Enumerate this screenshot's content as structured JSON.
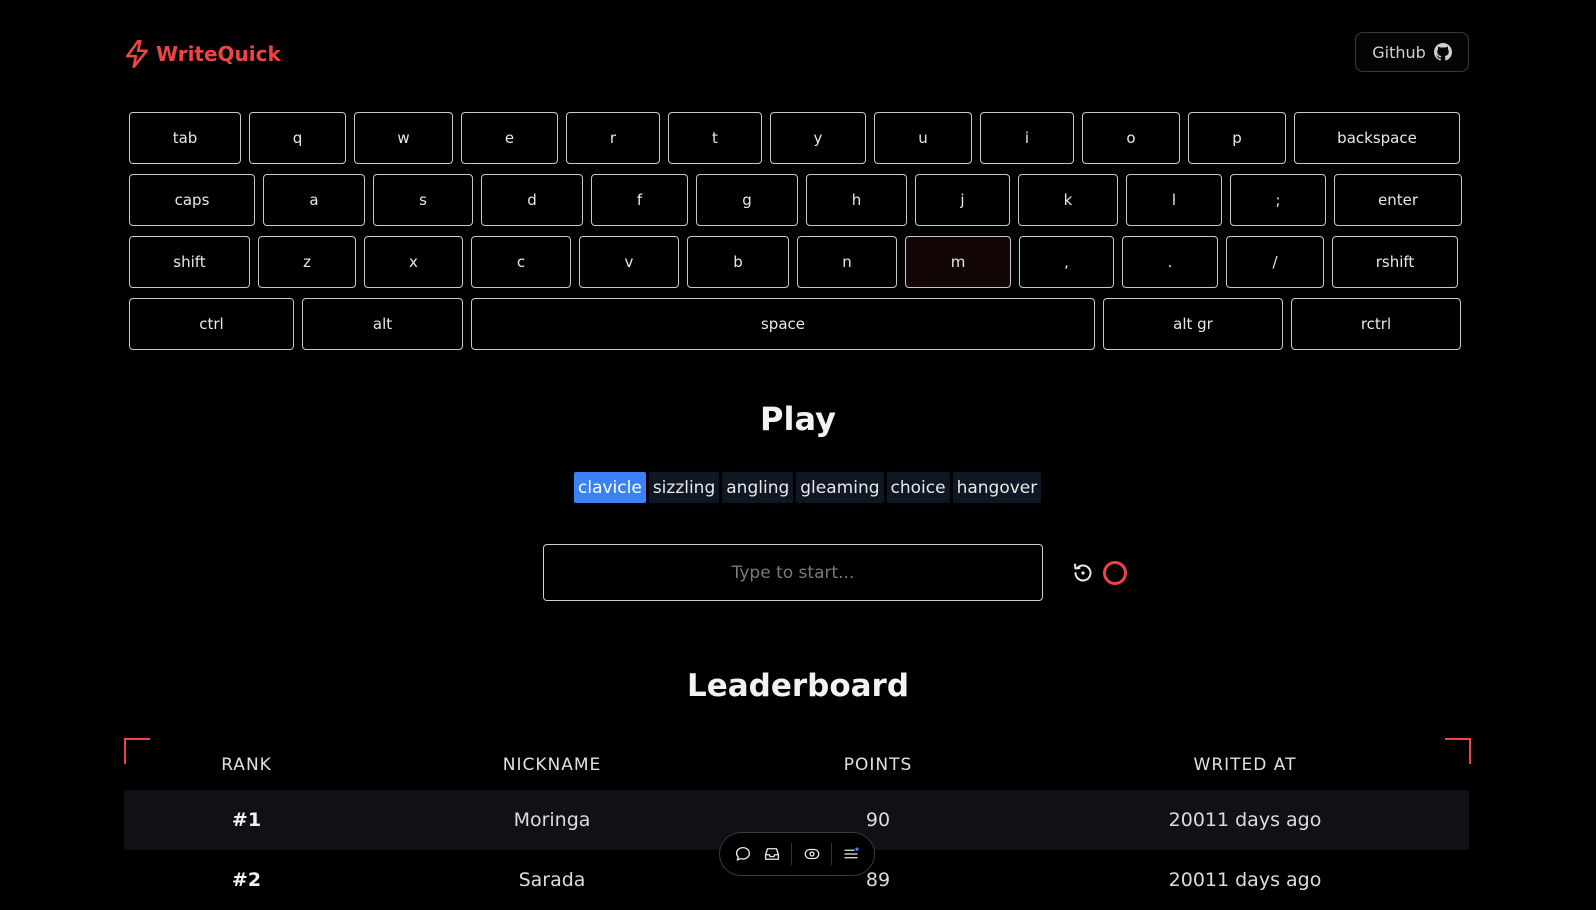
{
  "header": {
    "brand": "WriteQuick",
    "github_label": "Github",
    "accent": "#ef4444"
  },
  "keyboard": {
    "rows": [
      [
        "tab",
        "q",
        "w",
        "e",
        "r",
        "t",
        "y",
        "u",
        "i",
        "o",
        "p",
        "backspace"
      ],
      [
        "caps",
        "a",
        "s",
        "d",
        "f",
        "g",
        "h",
        "j",
        "k",
        "l",
        ";",
        "enter"
      ],
      [
        "shift",
        "z",
        "x",
        "c",
        "v",
        "b",
        "n",
        "m",
        ",",
        ".",
        "/",
        "rshift"
      ],
      [
        "ctrl",
        "alt",
        "space",
        "alt gr",
        "rctrl"
      ]
    ],
    "highlighted_key": "m"
  },
  "play": {
    "title": "Play",
    "words": [
      "clavicle",
      "sizzling",
      "angling",
      "gleaming",
      "choice",
      "hangover"
    ],
    "active_word_index": 0,
    "input_placeholder": "Type to start...",
    "input_value": ""
  },
  "leaderboard": {
    "title": "Leaderboard",
    "columns": [
      "RANK",
      "NICKNAME",
      "POINTS",
      "WRITED AT"
    ],
    "rows": [
      {
        "rank": "#1",
        "nickname": "Moringa",
        "points": "90",
        "writed_at": "20011 days ago"
      },
      {
        "rank": "#2",
        "nickname": "Sarada",
        "points": "89",
        "writed_at": "20011 days ago"
      }
    ]
  },
  "floating_toolbar": {
    "icons": [
      "chat-bubble-icon",
      "inbox-icon",
      "eye-icon",
      "menu-icon"
    ]
  }
}
